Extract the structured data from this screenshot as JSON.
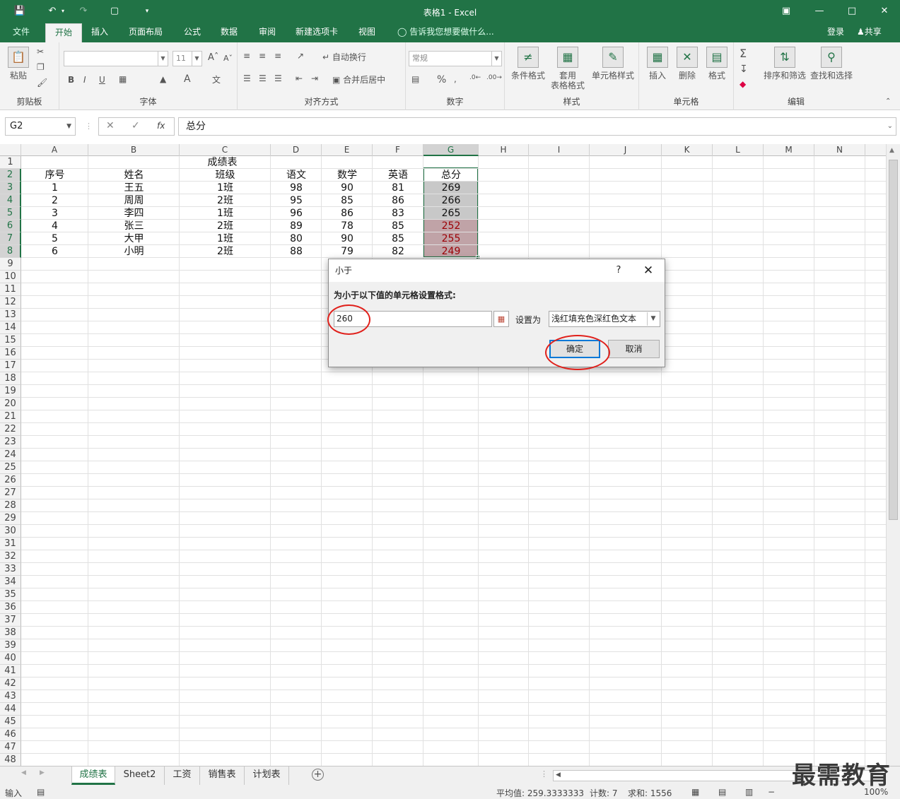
{
  "window": {
    "title": "表格1 - Excel"
  },
  "ribbon": {
    "file_tab": "文件",
    "tabs": [
      "开始",
      "插入",
      "页面布局",
      "公式",
      "数据",
      "审阅",
      "新建选项卡",
      "视图"
    ],
    "tell_me": "告诉我您想要做什么...",
    "login": "登录",
    "share": "共享",
    "groups": {
      "clipboard": {
        "label": "剪贴板",
        "paste": "粘贴"
      },
      "font": {
        "label": "字体",
        "font_size": "11",
        "bold": "B",
        "italic": "I",
        "underline": "U"
      },
      "alignment": {
        "label": "对齐方式",
        "wrap": "自动换行",
        "merge": "合并后居中"
      },
      "number": {
        "label": "数字",
        "format": "常规",
        "percent": "%"
      },
      "styles": {
        "label": "样式",
        "conditional": "条件格式",
        "table_format_1": "套用",
        "table_format_2": "表格格式",
        "cell_styles": "单元格样式"
      },
      "cells": {
        "label": "单元格",
        "insert": "插入",
        "delete": "删除",
        "format": "格式"
      },
      "editing": {
        "label": "编辑",
        "sort": "排序和筛选",
        "find": "查找和选择"
      }
    }
  },
  "formula_bar": {
    "name_box": "G2",
    "fx": "fx",
    "content": "总分"
  },
  "sheet": {
    "columns": [
      "A",
      "B",
      "C",
      "D",
      "E",
      "F",
      "G",
      "H",
      "I",
      "J",
      "K",
      "L",
      "M",
      "N"
    ],
    "selected_column": "G",
    "title": "成绩表",
    "headers": [
      "序号",
      "姓名",
      "班级",
      "语文",
      "数学",
      "英语",
      "总分"
    ],
    "rows": [
      [
        "1",
        "王五",
        "1班",
        "98",
        "90",
        "81",
        "269"
      ],
      [
        "2",
        "周周",
        "2班",
        "95",
        "85",
        "86",
        "266"
      ],
      [
        "3",
        "李四",
        "1班",
        "96",
        "86",
        "83",
        "265"
      ],
      [
        "4",
        "张三",
        "2班",
        "89",
        "78",
        "85",
        "252"
      ],
      [
        "5",
        "大甲",
        "1班",
        "80",
        "90",
        "85",
        "255"
      ],
      [
        "6",
        "小明",
        "2班",
        "88",
        "79",
        "82",
        "249"
      ]
    ],
    "highlight": {
      "threshold_color": "#c0a3a7",
      "normal_color": "#c8c8c8",
      "red_text": "#9c0006"
    },
    "row_count": 48
  },
  "dialog": {
    "title": "小于",
    "help": "?",
    "close": "✕",
    "prompt": "为小于以下值的单元格设置格式:",
    "value": "260",
    "set_as_label": "设置为",
    "format_option": "浅红填充色深红色文本",
    "ok": "确定",
    "cancel": "取消"
  },
  "sheet_tabs": [
    "成绩表",
    "Sheet2",
    "工资",
    "销售表",
    "计划表"
  ],
  "status": {
    "mode": "输入",
    "average": "平均值: 259.3333333",
    "count": "计数: 7",
    "sum": "求和: 1556",
    "zoom": "100%"
  },
  "watermark": "最需教育",
  "colors": {
    "excel_green": "#217346",
    "annotation_red": "#e0201b"
  }
}
